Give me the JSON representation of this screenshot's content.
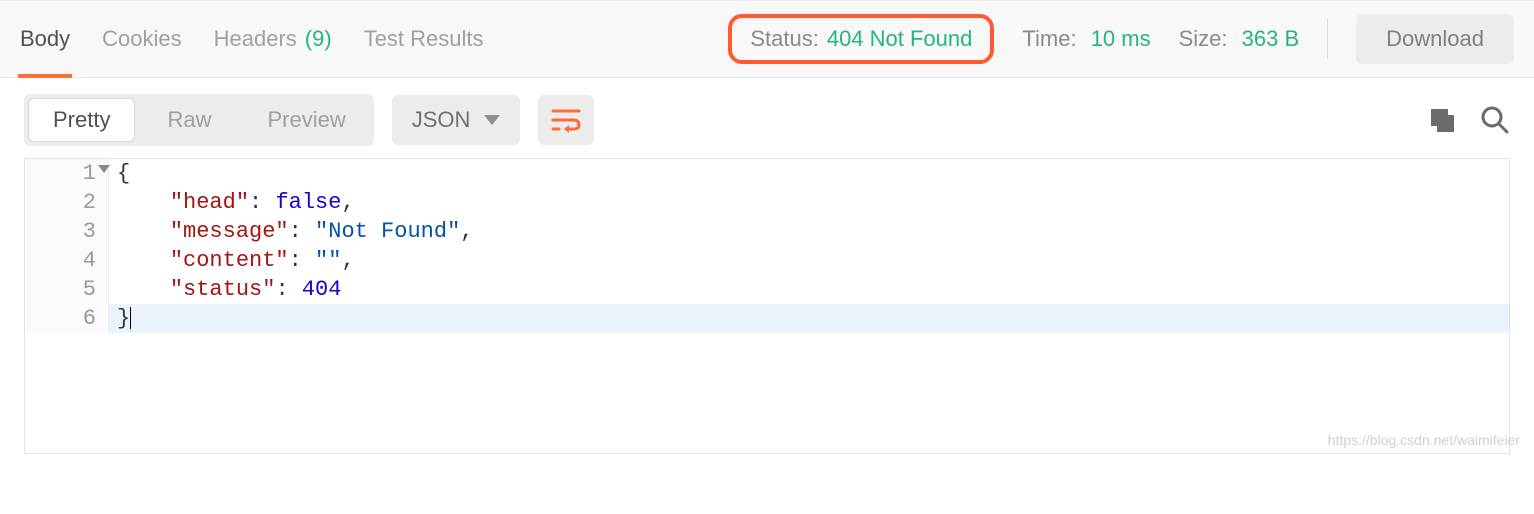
{
  "tabs": {
    "body": "Body",
    "cookies": "Cookies",
    "headers": "Headers",
    "headers_count": "(9)",
    "test": "Test Results"
  },
  "status": {
    "status_label": "Status:",
    "status_value": "404 Not Found",
    "time_label": "Time:",
    "time_value": "10 ms",
    "size_label": "Size:",
    "size_value": "363 B"
  },
  "download_label": "Download",
  "view_modes": {
    "pretty": "Pretty",
    "raw": "Raw",
    "preview": "Preview"
  },
  "format_label": "JSON",
  "code": {
    "l1_num": "1",
    "l1": "{",
    "l2_num": "2",
    "l2_key": "\"head\"",
    "l2_val": "false",
    "l3_num": "3",
    "l3_key": "\"message\"",
    "l3_val": "\"Not Found\"",
    "l4_num": "4",
    "l4_key": "\"content\"",
    "l4_val": "\"\"",
    "l5_num": "5",
    "l5_key": "\"status\"",
    "l5_val": "404",
    "l6_num": "6",
    "l6": "}"
  },
  "watermark": "https://blog.csdn.net/waimifeier"
}
